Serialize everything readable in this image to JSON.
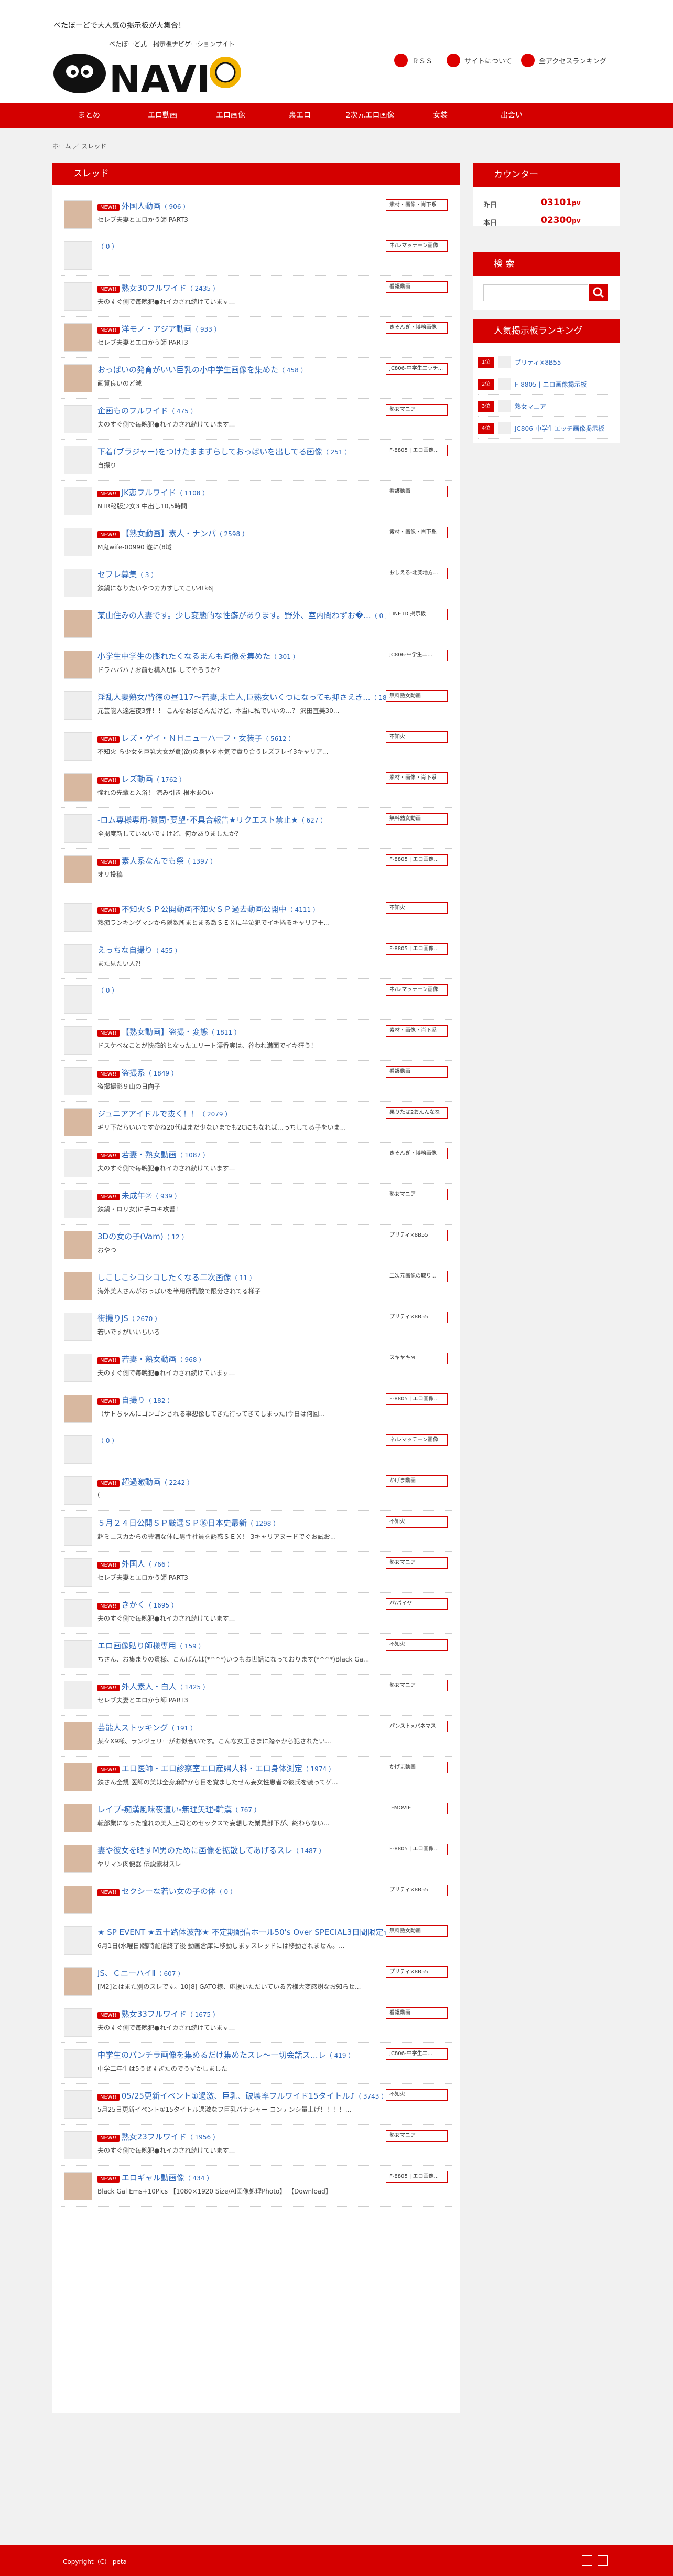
{
  "tagline": "べたぼーどで大人気の掲示板が大集合！",
  "header_links": [
    "ＲＳＳ",
    "サイトについて",
    "全アクセスランキング"
  ],
  "nav": [
    "まとめ",
    "エロ動画",
    "エロ画像",
    "裏エロ",
    "2次元エロ画像",
    "女装",
    "出会い"
  ],
  "crumb": "ホーム ／ スレッド",
  "threads_title": "スレッド",
  "threads": [
    {
      "t": "外国人動画",
      "c": "（ 906 ）",
      "d": "セレブ夫妻とエロかう師 PART3",
      "g": "素材・画像・肖下系",
      "n": 1,
      "p": 1
    },
    {
      "t": "",
      "c": "（ 0 ）",
      "d": "",
      "g": "ネ/レマッテーン画像",
      "n": 0,
      "p": 0
    },
    {
      "t": "熟女30フルワイド",
      "c": "（ 2435 ）",
      "d": "夫のすぐ側で毎晩犯●れイカされ続けています…",
      "g": "看護動画",
      "n": 1,
      "p": 0
    },
    {
      "t": "洋モノ・アジア動画",
      "c": "（ 933 ）",
      "d": "セレブ夫妻とエロかう師 PART3",
      "g": "きそんぎ・博務画像",
      "n": 1,
      "p": 1
    },
    {
      "t": "おっぱいの発育がいい巨乳の小中学生画像を集めた",
      "c": "（ 458 ）",
      "d": "画質良いのど滅",
      "g": "JC806-中学生エッチ...",
      "n": 0,
      "p": 1
    },
    {
      "t": "企画ものフルワイド",
      "c": "（ 475 ）",
      "d": "夫のすぐ側で毎晩犯●れイカされ続けています…",
      "g": "熟女マニア",
      "n": 0,
      "p": 0
    },
    {
      "t": "下着(ブラジャー)をつけたままずらしておっぱいを出してる画像",
      "c": "（ 251 ）",
      "d": "自撮り",
      "g": "F-8805 | エロ画像...",
      "n": 0,
      "p": 0
    },
    {
      "t": "JK恋フルワイド",
      "c": "（ 1108 ）",
      "d": "NTR秘版少女3 中出し10,5時間",
      "g": "看護動画",
      "n": 1,
      "p": 0
    },
    {
      "t": "【熟女動画】素人・ナンパ",
      "c": "（ 2598 ）",
      "d": "M鬼wife-00990 遂に(8域",
      "g": "素材・画像・肖下系",
      "n": 1,
      "p": 0
    },
    {
      "t": "セフレ募集",
      "c": "（ 3 ）",
      "d": "鉄鍋になりたいやつカカすしてこい4tk6J",
      "g": "おしえる-北斐地方...",
      "n": 0,
      "p": 0
    },
    {
      "t": "某山住みの人妻です。少し変態的な性癖があります。野外、室内問わずお�...",
      "c": "（ 0 ）",
      "d": "",
      "g": "LINE ID 掲示板",
      "n": 0,
      "p": 1
    },
    {
      "t": "小学生中学生の膨れたくなるまんも画像を集めた",
      "c": "（ 301 ）",
      "d": "ドラハバハ / お前も構入朋にしてやろうか?",
      "g": "JC806-中学生エ...",
      "n": 0,
      "p": 1
    },
    {
      "t": "淫乱人妻熟女/背徳の昼117～若妻,未亡人,巨熟女いくつになっても抑さえき...",
      "c": "（ 186 ）",
      "d": "元芸能人達淫夜3弾！！ こんなおばさんだけど、本当に私でいいの…？ 沢田直美30...",
      "g": "無料熟女動画",
      "n": 0,
      "p": 0
    },
    {
      "t": "レズ・ゲイ・ＮＨニューハーフ・女装子",
      "c": "（ 5612 ）",
      "d": "不知火 ら少女を巨乳大女が貪(欲)の身体を本気で責り合うレズプレイ3キャリア...",
      "g": "不知火",
      "n": 1,
      "p": 0
    },
    {
      "t": "レズ動画",
      "c": "（ 1762 ）",
      "d": "憧れの先輩と入浴！ 涼み引き 根本あOい",
      "g": "素材・画像・肖下系",
      "n": 1,
      "p": 1
    },
    {
      "t": "-ロム専様専用-質問･要望･不具合報告★リクエスト禁止★",
      "c": "（ 627 ）",
      "d": "全掲度新していないですけど、何かありましたか？",
      "g": "無料熟女動画",
      "n": 0,
      "p": 0
    },
    {
      "t": "素人系なんでも祭",
      "c": "（ 1397 ）",
      "d": "オリ投稿",
      "g": "F-8805 | エロ画像...",
      "n": 1,
      "p": 2
    },
    {
      "t": "不知火ＳＰ公開動画不知火ＳＰ過去動画公開中",
      "c": "（ 4111 ）",
      "d": "熟痴ランキングマンから隠数所まとまる激ＳＥＸに半泣犯でイキ捲るキャリア＋...",
      "g": "不知火",
      "n": 1,
      "p": 0
    },
    {
      "t": "えっちな自撮り",
      "c": "（ 455 ）",
      "d": "また見たい人?!",
      "g": "F-8805 | エロ画像...",
      "n": 0,
      "p": 0
    },
    {
      "t": "",
      "c": "（ 0 ）",
      "d": "",
      "g": "ネ/レマッテーン画像",
      "n": 0,
      "p": 0
    },
    {
      "t": "【熟女動画】盗撮・変態",
      "c": "（ 1811 ）",
      "d": "ドスケベなことが快感的となったエリート漂香実は、谷われ満面でイキ狂う！",
      "g": "素材・画像・肖下系",
      "n": 1,
      "p": 0
    },
    {
      "t": "盗撮系",
      "c": "（ 1849 ）",
      "d": "盗撮撮影９山の日向子",
      "g": "看護動画",
      "n": 1,
      "p": 0
    },
    {
      "t": "ジュニアアイドルで抜く！！",
      "c": "（ 2079 ）",
      "d": "ギリ下だらいいですかね20代はまだ少ないまでも2Cにもなれば…っちしてる子をいま...",
      "g": "果りたは2おんんなな",
      "n": 0,
      "p": 1
    },
    {
      "t": "若妻・熟女動画",
      "c": "（ 1087 ）",
      "d": "夫のすぐ側で毎晩犯●れイカされ続けています…",
      "g": "きそんぎ・博務画像",
      "n": 1,
      "p": 0
    },
    {
      "t": "未成年②",
      "c": "（ 939 ）",
      "d": "鉄鍋・ロリ女(に手コキ攻響！",
      "g": "熟女マニア",
      "n": 1,
      "p": 0
    },
    {
      "t": "3Dの女の子(Vam)",
      "c": "（ 12 ）",
      "d": "おやつ",
      "g": "プリティ×8B55",
      "n": 0,
      "p": 1
    },
    {
      "t": "しこしこシコシコしたくなる二次画像",
      "c": "（ 11 ）",
      "d": "海外美人さんがおっぱいを半用所乳酸で限分されてる様子",
      "g": "二次元画像の取り...",
      "n": 0,
      "p": 1
    },
    {
      "t": "街撮りJS",
      "c": "（ 2670 ）",
      "d": "若いですがいいちいろ",
      "g": "プリティ×8B55",
      "n": 0,
      "p": 0
    },
    {
      "t": "若妻・熟女動画",
      "c": "（ 968 ）",
      "d": "夫のすぐ側で毎晩犯●れイカされ続けています…",
      "g": "スキヤキM",
      "n": 1,
      "p": 0
    },
    {
      "t": "自撮り",
      "c": "（ 182 ）",
      "d": "（サトちゃんにゴンゴンされる事想像してきた行ってきてしまった)今日は何回...",
      "g": "F-8805 | エロ画像...",
      "n": 1,
      "p": 1
    },
    {
      "t": "",
      "c": "（ 0 ）",
      "d": "",
      "g": "ネ/レマッテーン画像",
      "n": 0,
      "p": 0
    },
    {
      "t": "超過激動画",
      "c": "（ 2242 ）",
      "d": "(",
      "g": "かげま動画",
      "n": 1,
      "p": 0
    },
    {
      "t": "５月２４日公開ＳＰ厳選ＳＰ⑯日本史最新",
      "c": "（ 1298 ）",
      "d": "超ミニスカからの豊満な体に男性社員を誘惑ＳＥＸ！ 3キャリアヌードでぐお試お...",
      "g": "不知火",
      "n": 0,
      "p": 0
    },
    {
      "t": "外国人",
      "c": "（ 766 ）",
      "d": "セレブ夫妻とエロかう師 PART3",
      "g": "熟女マニア",
      "n": 1,
      "p": 0
    },
    {
      "t": "きかく",
      "c": "（ 1695 ）",
      "d": "夫のすぐ側で毎晩犯●れイカされ続けています…",
      "g": "パ/パイヤ",
      "n": 1,
      "p": 0
    },
    {
      "t": "エロ画像貼り師様専用",
      "c": "（ 159 ）",
      "d": "ちさん、お集まりの貫様、こんばんは(*^^*)いつもお世話になっております(*^^*)Black Ga...",
      "g": "不知火",
      "n": 0,
      "p": 0
    },
    {
      "t": "外人素人・白人",
      "c": "（ 1425 ）",
      "d": "セレブ夫妻とエロかう師 PART3",
      "g": "熟女マニア",
      "n": 1,
      "p": 0
    },
    {
      "t": "芸能人ストッキング",
      "c": "（ 191 ）",
      "d": "某々X9様、ランジェリーがお似合いです。こんな女王さまに踏ゃから犯されたい...",
      "g": "パンスト×パネマス",
      "n": 0,
      "p": 1
    },
    {
      "t": "エロ医師・エロ診察室エロ産婦人科・エロ身体測定",
      "c": "（ 1974 ）",
      "d": "鉄さん全規 医師の美は全身麻酔から目を覚ましたせん妄女性患者の彼氏を装ってゲ...",
      "g": "かげま動画",
      "n": 1,
      "p": 1
    },
    {
      "t": "レイプ-痴漢風味夜這い-無理矢理-輪漢",
      "c": "（ 767 ）",
      "d": "転部業になった憧れの美人上司とのセックスで妄想した業員部下が、終わらない...",
      "g": "IFMOVIE",
      "n": 0,
      "p": 1
    },
    {
      "t": "妻や彼女を晒すM男のために画像を拡散してあげるスレ",
      "c": "（ 1487 ）",
      "d": "ヤリマン肉便器 伝説素材スレ",
      "g": "F-8805 | エロ画像...",
      "n": 0,
      "p": 1
    },
    {
      "t": "セクシーな若い女の子の体",
      "c": "（ 0 ）",
      "d": "",
      "g": "プリティ×8B55",
      "n": 1,
      "p": 1
    },
    {
      "t": "★ SP EVENT ★五十路体波部★ 不定期配信ホール50's Over SPECIAL3日間限定☆◆...",
      "c": "（ 42 ）",
      "d": "6月1日(水曜日)臨時配信終了後 動画倉庫に移動しますスレッドには移動されません。...",
      "g": "無料熟女動画",
      "n": 0,
      "p": 0
    },
    {
      "t": "JS、ＣニーハイⅡ",
      "c": "（ 607 ）",
      "d": "[M2]とはまた別のスレです。10[8] GATO様、応援いただいている皆様大変感謝なお知らせ...",
      "g": "プリティ×8B55",
      "n": 0,
      "p": 1
    },
    {
      "t": "熟女33フルワイド",
      "c": "（ 1675 ）",
      "d": "夫のすぐ側で毎晩犯●れイカされ続けています…",
      "g": "看護動画",
      "n": 1,
      "p": 0
    },
    {
      "t": "中学生のパンチラ画像を集めるだけ集めたスレ～一切会話ス…レ",
      "c": "（ 419 ）",
      "d": "中学二年生は5うぜすぎたのでうずかしました",
      "g": "JC806-中学生エ...",
      "n": 0,
      "p": 0
    },
    {
      "t": "05/25更新イベント①過激、巨乳、破壊率フルワイド15タイトル♪",
      "c": "（ 3743 ）",
      "d": "5月25日更新イベント①15タイトル過激なフ巨乳バナシャー コンテンシ量上げ！！！！...",
      "g": "不知火",
      "n": 1,
      "p": 0
    },
    {
      "t": "熟女23フルワイド",
      "c": "（ 1956 ）",
      "d": "夫のすぐ側で毎晩犯●れイカされ続けています…",
      "g": "熟女マニア",
      "n": 1,
      "p": 0
    },
    {
      "t": "エロギャル動画像",
      "c": "（ 434 ）",
      "d": "Black Gal Ems+10Pics 【1080×1920 Size/Al画像処理Photo】 【Download】",
      "g": "F-8805 | エロ画像...",
      "n": 1,
      "p": 1
    }
  ],
  "counter_title": "カウンター",
  "counter": {
    "yday_label": "昨日",
    "yday": "03101",
    "today_label": "本日",
    "today": "02300",
    "unit": "pv"
  },
  "search_title": "検 索",
  "search_btn_icon": "search-icon",
  "ranking_title": "人気掲示板ランキング",
  "ranking": [
    {
      "no": "1位",
      "name": "プリティ×8B55"
    },
    {
      "no": "2位",
      "name": "F-8805 | エロ画像掲示板"
    },
    {
      "no": "3位",
      "name": "熟女マニア"
    },
    {
      "no": "4位",
      "name": "JC806-中学生エッチ画像掲示板"
    }
  ],
  "new_badge": "NEW!!",
  "copyright": "Copyright（C） peta",
  "colors": {
    "accent": "#d40000",
    "link": "#2a64b8"
  }
}
